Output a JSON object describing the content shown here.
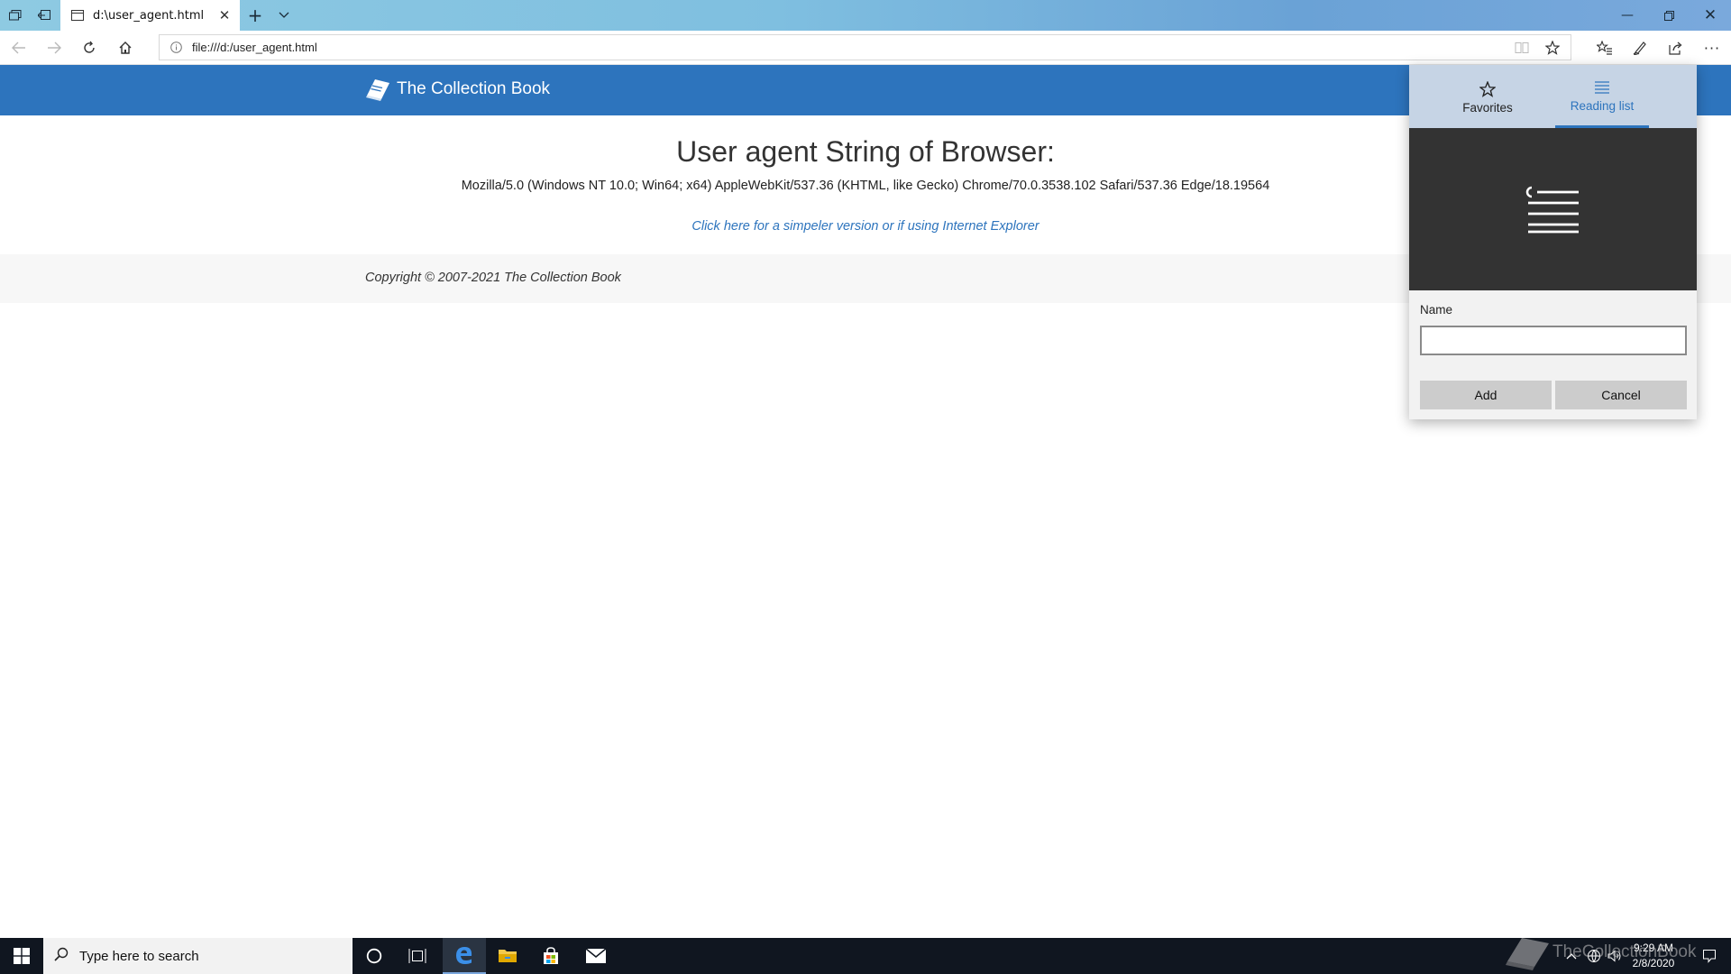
{
  "browser": {
    "tab_title": "d:\\user_agent.html",
    "address": "file:///d:/user_agent.html",
    "icons": [
      "tab-preview-icon",
      "set-aside-tabs-icon",
      "new-tab-icon",
      "tab-list-chevron-icon",
      "back-icon",
      "forward-icon",
      "refresh-icon",
      "home-icon",
      "info-icon",
      "reading-view-icon",
      "favorite-star-icon",
      "favorites-hub-icon",
      "pen-icon",
      "share-icon",
      "more-icon",
      "minimize-icon",
      "restore-icon",
      "close-icon"
    ]
  },
  "page": {
    "brand": "The Collection Book",
    "title": "User agent String of Browser:",
    "user_agent": "Mozilla/5.0 (Windows NT 10.0; Win64; x64) AppleWebKit/537.36 (KHTML, like Gecko) Chrome/70.0.3538.102 Safari/537.36 Edge/18.19564",
    "simple_link": "Click here for a simpeler version or if using Internet Explorer",
    "copyright": "Copyright © 2007-2021 The Collection Book",
    "header_color": "#2d74bd"
  },
  "hub": {
    "tabs": [
      {
        "label": "Favorites",
        "icon": "star-icon",
        "active": false
      },
      {
        "label": "Reading list",
        "icon": "reading-list-icon",
        "active": true
      }
    ],
    "name_label": "Name",
    "name_value": "",
    "add_label": "Add",
    "cancel_label": "Cancel"
  },
  "taskbar": {
    "search_placeholder": "Type here to search",
    "apps": [
      "cortana-icon",
      "task-view-icon",
      "edge-icon",
      "file-explorer-icon",
      "store-icon",
      "mail-icon"
    ],
    "time": "9:29 AM",
    "date": "2/8/2020",
    "watermark": "TheCollectionBook"
  }
}
